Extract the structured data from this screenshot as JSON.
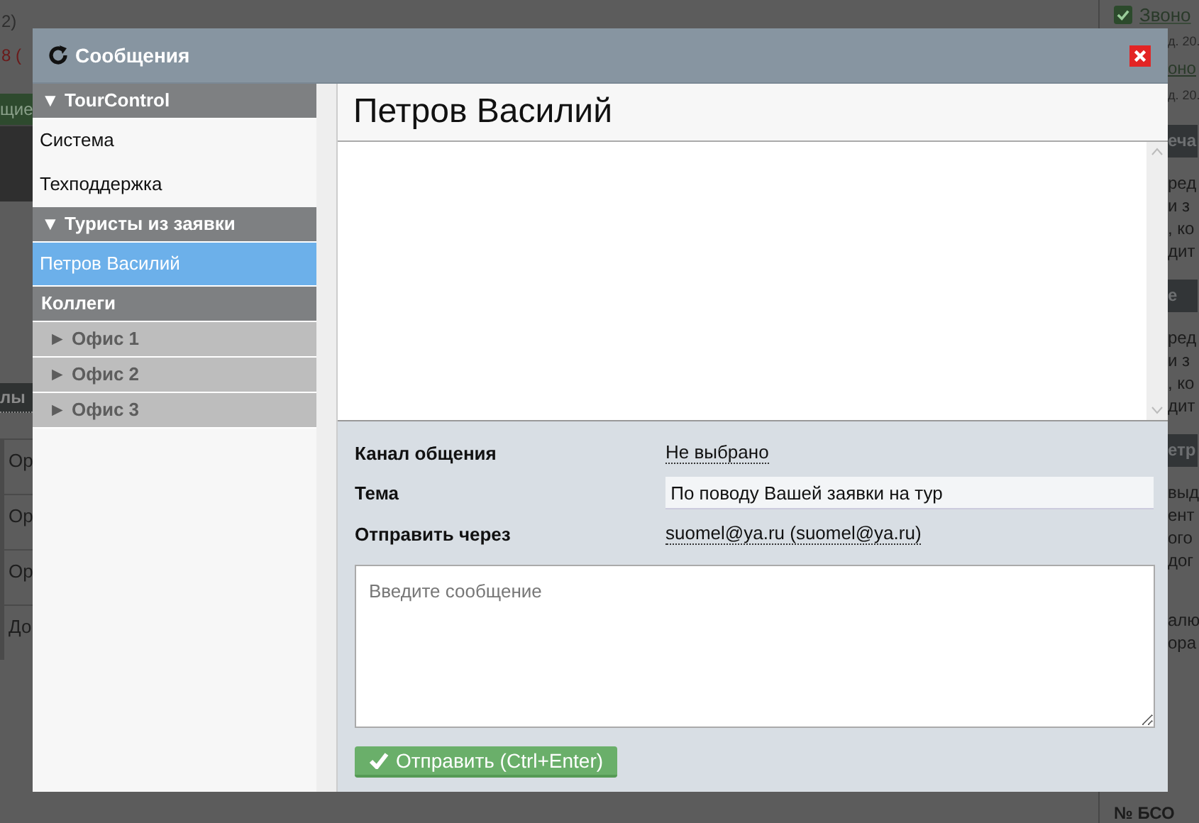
{
  "background": {
    "left": [
      {
        "kind": "plain",
        "text": "2)"
      },
      {
        "kind": "count",
        "text": "8 ("
      },
      {
        "kind": "band",
        "text": "щие"
      },
      {
        "kind": "dark"
      },
      {
        "kind": "link",
        "text": "лы"
      },
      {
        "kind": "row",
        "text": "Ор"
      },
      {
        "kind": "row",
        "text": "Ор"
      },
      {
        "kind": "row",
        "text": "Ор"
      },
      {
        "kind": "row",
        "text": "До"
      }
    ],
    "top_task": {
      "checked": true,
      "text": "Звоно"
    },
    "right": [
      {
        "kind": "date",
        "text": "д. 20."
      },
      {
        "kind": "task",
        "text": "оно"
      },
      {
        "kind": "date",
        "text": "д. 20."
      },
      {
        "kind": "header",
        "text": "еча"
      },
      {
        "kind": "text",
        "text": "ред"
      },
      {
        "kind": "text",
        "text": "и з"
      },
      {
        "kind": "text",
        "text": ", ко"
      },
      {
        "kind": "text",
        "text": "дит"
      },
      {
        "kind": "header",
        "text": "е"
      },
      {
        "kind": "text",
        "text": "ред"
      },
      {
        "kind": "text",
        "text": "и з"
      },
      {
        "kind": "text",
        "text": ", ко"
      },
      {
        "kind": "text",
        "text": "дит"
      },
      {
        "kind": "header",
        "text": "етр"
      },
      {
        "kind": "text",
        "text": "выд"
      },
      {
        "kind": "text",
        "text": "ент"
      },
      {
        "kind": "text",
        "text": "ого"
      },
      {
        "kind": "text",
        "text": "дог"
      },
      {
        "kind": "gap"
      },
      {
        "kind": "text",
        "text": "алю"
      },
      {
        "kind": "text",
        "text": "ора"
      }
    ],
    "bottom_label": "№ БСО"
  },
  "dialog": {
    "title": "Сообщения",
    "sidebar": [
      {
        "kind": "header",
        "label": "▼ TourControl"
      },
      {
        "kind": "contact",
        "label": "Система",
        "selected": false
      },
      {
        "kind": "contact",
        "label": "Техподдержка",
        "selected": false
      },
      {
        "kind": "header",
        "label": "▼ Туристы из заявки"
      },
      {
        "kind": "contact",
        "label": "Петров Василий",
        "selected": true
      },
      {
        "kind": "header",
        "label": "Коллеги"
      },
      {
        "kind": "subgroup",
        "label": "► Офис 1"
      },
      {
        "kind": "subgroup",
        "label": "► Офис 2"
      },
      {
        "kind": "subgroup",
        "label": "► Офис 3"
      }
    ],
    "contact_name": "Петров Василий",
    "form": {
      "fields": [
        {
          "kind": "link",
          "label": "Канал общения",
          "value": "Не выбрано"
        },
        {
          "kind": "input",
          "label": "Тема",
          "value": "По поводу Вашей заявки на тур"
        },
        {
          "kind": "link",
          "label": "Отправить через",
          "value": "suomel@ya.ru (suomel@ya.ru)"
        }
      ],
      "message_placeholder": "Введите сообщение",
      "send_button": "Отправить (Ctrl+Enter)"
    }
  }
}
